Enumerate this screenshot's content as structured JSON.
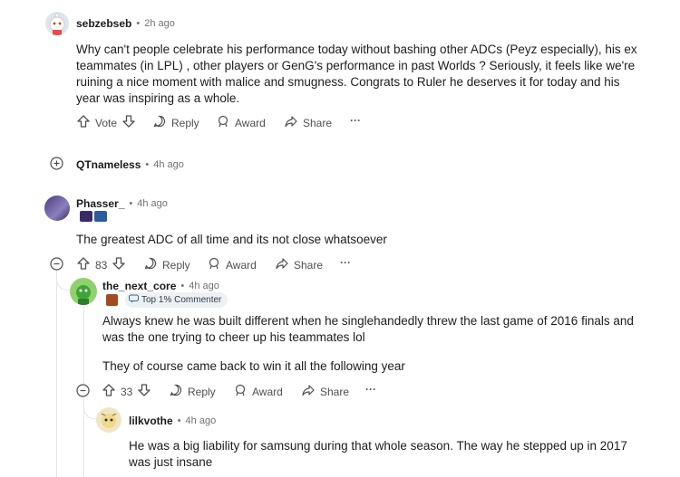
{
  "comment1": {
    "username": "sebzebseb",
    "time": "2h ago",
    "body": "Why can't people celebrate his performance today without bashing other ADCs (Peyz especially), his ex teammates (in LPL) , other players or GenG's performance in past Worlds ? Seriously, it feels like we're ruining a nice moment with malice and smugness. Congrats to Ruler he deserves it for today and his year was inspiring as a whole.",
    "vote_label": "Vote",
    "reply_label": "Reply",
    "award_label": "Award",
    "share_label": "Share",
    "more": "···"
  },
  "collapsed": {
    "username": "QTnameless",
    "time": "4h ago"
  },
  "comment2": {
    "username": "Phasser_",
    "time": "4h ago",
    "body": "The greatest ADC of all time and its not close whatsoever",
    "score": "83",
    "reply_label": "Reply",
    "award_label": "Award",
    "share_label": "Share",
    "more": "···"
  },
  "comment3": {
    "username": "the_next_core",
    "time": "4h ago",
    "badge": "Top 1% Commenter",
    "body1": "Always knew he was built different when he singlehandedly threw the last game of 2016 finals and was the one trying to cheer up his teammates lol",
    "body2": "They of course came back to win it all the following year",
    "score": "33",
    "reply_label": "Reply",
    "award_label": "Award",
    "share_label": "Share",
    "more": "···"
  },
  "comment4": {
    "username": "lilkvothe",
    "time": "4h ago",
    "body": "He was a big liability for samsung during that whole season. The way he stepped up in 2017 was just insane"
  },
  "separator": "•"
}
